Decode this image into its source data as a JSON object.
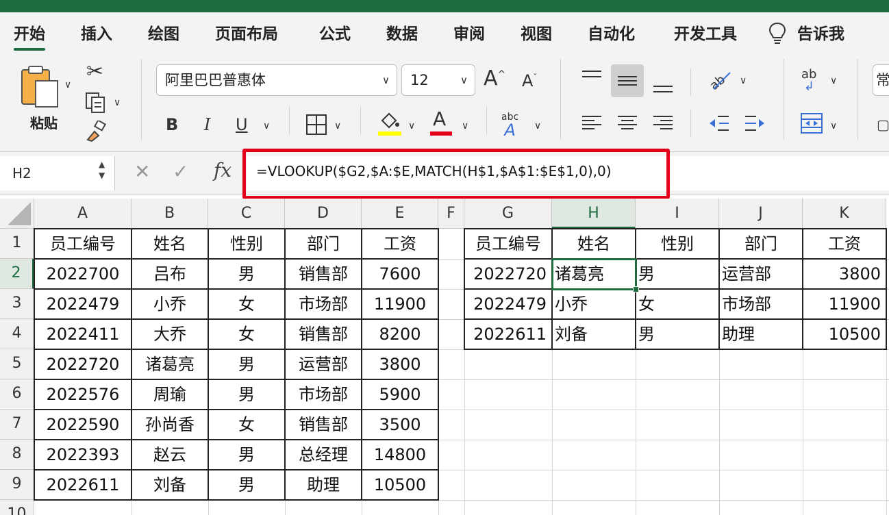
{
  "tabs": [
    "开始",
    "插入",
    "绘图",
    "页面布局",
    "公式",
    "数据",
    "审阅",
    "视图",
    "自动化",
    "开发工具",
    "告诉我"
  ],
  "ribbon": {
    "paste_label": "粘贴",
    "font_name": "阿里巴巴普惠体",
    "font_size": "12",
    "bold": "B",
    "italic": "I",
    "underline": "U",
    "font_color_glyph": "A",
    "grow_font": "A",
    "shrink_font": "A",
    "phonetic": "abc",
    "wrap_text": "ab",
    "style_partial": "常"
  },
  "colors": {
    "accent": "#1e6b3e",
    "highlight": "#ffff00",
    "font_color": "#e3001b",
    "callout": "#e3001b"
  },
  "formula_bar": {
    "name_box": "H2",
    "cancel_glyph": "✕",
    "enter_glyph": "✓",
    "fx_label": "fx",
    "formula": "=VLOOKUP($G2,$A:$E,MATCH(H$1,$A$1:$E$1,0),0)"
  },
  "sheet": {
    "columns": [
      "A",
      "B",
      "C",
      "D",
      "E",
      "F",
      "G",
      "H",
      "I",
      "J",
      "K"
    ],
    "rows": [
      "1",
      "2",
      "3",
      "4",
      "5",
      "6",
      "7",
      "8",
      "9",
      "10"
    ],
    "source_table": [
      [
        "员工编号",
        "姓名",
        "性别",
        "部门",
        "工资"
      ],
      [
        "2022700",
        "吕布",
        "男",
        "销售部",
        "7600"
      ],
      [
        "2022479",
        "小乔",
        "女",
        "市场部",
        "11900"
      ],
      [
        "2022411",
        "大乔",
        "女",
        "销售部",
        "8200"
      ],
      [
        "2022720",
        "诸葛亮",
        "男",
        "运营部",
        "3800"
      ],
      [
        "2022576",
        "周瑜",
        "男",
        "市场部",
        "5900"
      ],
      [
        "2022590",
        "孙尚香",
        "女",
        "销售部",
        "3500"
      ],
      [
        "2022393",
        "赵云",
        "男",
        "总经理",
        "14800"
      ],
      [
        "2022611",
        "刘备",
        "男",
        "助理",
        "10500"
      ]
    ],
    "lookup_table": [
      [
        "员工编号",
        "姓名",
        "性别",
        "部门",
        "工资"
      ],
      [
        "2022720",
        "诸葛亮",
        "男",
        "运营部",
        "3800"
      ],
      [
        "2022479",
        "小乔",
        "女",
        "市场部",
        "11900"
      ],
      [
        "2022611",
        "刘备",
        "男",
        "助理",
        "10500"
      ]
    ]
  }
}
